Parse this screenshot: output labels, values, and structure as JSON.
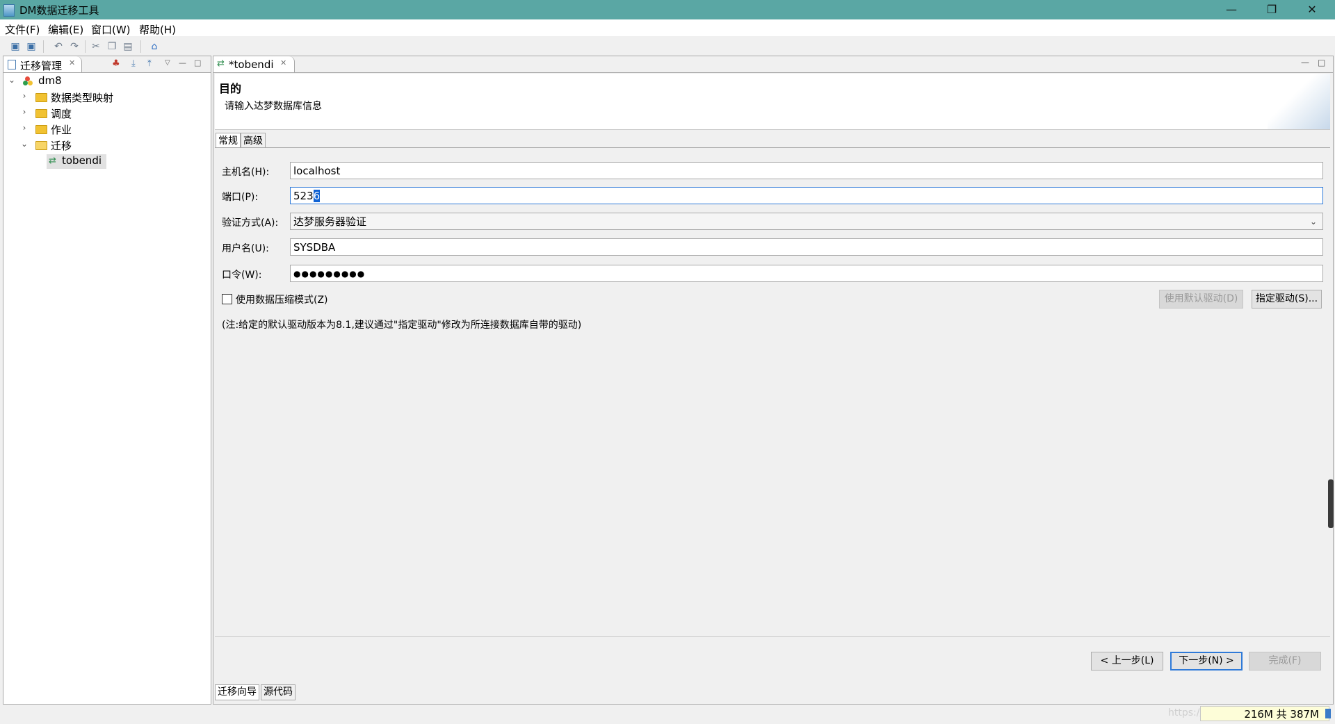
{
  "window": {
    "title": "DM数据迁移工具",
    "controls": [
      "—",
      "❐",
      "✕"
    ]
  },
  "menu": [
    "文件(F)",
    "编辑(E)",
    "窗口(W)",
    "帮助(H)"
  ],
  "toolbar": {
    "icons": [
      "save-icon",
      "save-all-icon",
      "undo-icon",
      "redo-icon",
      "cut-icon",
      "copy-icon",
      "paste-icon",
      "home-icon"
    ]
  },
  "left_panel": {
    "tab_label": "迁移管理",
    "tree": {
      "root": "dm8",
      "items": [
        "数据类型映射",
        "调度",
        "作业",
        "迁移"
      ],
      "child": "tobendi"
    }
  },
  "editor": {
    "tab_label": "*tobendi",
    "header_title": "目的",
    "header_desc": "请输入达梦数据库信息",
    "subtabs": [
      "常规",
      "高级"
    ],
    "form": {
      "host_label": "主机名(H):",
      "host_value": "localhost",
      "port_label": "端口(P):",
      "port_value_plain": "523",
      "port_value_selected": "6",
      "auth_label": "验证方式(A):",
      "auth_value": "达梦服务器验证",
      "user_label": "用户名(U):",
      "user_value": "SYSDBA",
      "password_label": "口令(W):",
      "password_value": "●●●●●●●●●",
      "compress_label": "使用数据压缩模式(Z)",
      "compress_checked": false,
      "default_driver_button": "使用默认驱动(D)",
      "set_driver_button": "指定驱动(S)...",
      "note": "(注:给定的默认驱动版本为8.1,建议通过\"指定驱动\"修改为所连接数据库自带的驱动)"
    },
    "wizard_buttons": {
      "back": "< 上一步(L)",
      "next": "下一步(N) >",
      "finish": "完成(F)"
    },
    "page_tabs": [
      "迁移向导",
      "源代码"
    ]
  },
  "status": {
    "heap": "216M 共 387M",
    "watermark": "https://blog.csdn.net/..."
  },
  "colors": {
    "titlebar": "#5aa7a4",
    "accent": "#2f7ad8",
    "folder": "#f1c232"
  }
}
